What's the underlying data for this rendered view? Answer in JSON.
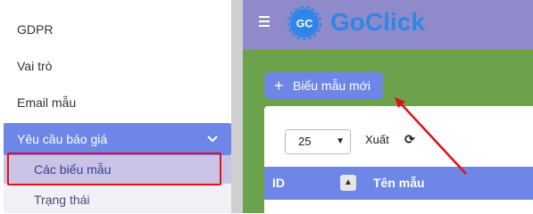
{
  "sidebar": {
    "items": [
      "GDPR",
      "Vai trò",
      "Email mẫu"
    ],
    "active_menu": "Yêu cầu báo giá",
    "submenu": [
      "Các biểu mẫu",
      "Trạng thái"
    ]
  },
  "header": {
    "logo_text": "GoClick",
    "logo_mark": "GC"
  },
  "main": {
    "new_button": "Biểu mẫu mới",
    "page_size": "25",
    "export_label": "Xuất",
    "table": {
      "columns": [
        "ID",
        "Tên mẫu"
      ]
    }
  },
  "colors": {
    "accent": "#6e86e8",
    "topbar": "#8f8ac9",
    "annotation": "#e0101a"
  }
}
